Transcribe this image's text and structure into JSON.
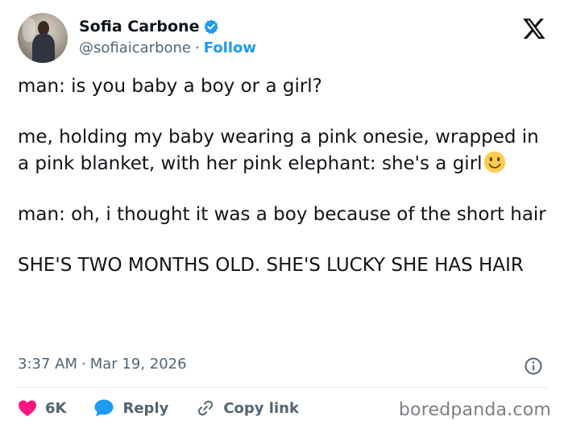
{
  "author": {
    "display_name": "Sofia Carbone",
    "handle": "@sofiaicarbone",
    "separator": "·",
    "follow_label": "Follow",
    "verified": true
  },
  "tweet": {
    "paragraphs": [
      "man: is you baby a boy or a girl?",
      "me, holding my baby wearing a pink onesie, wrapped in a pink blanket, with her pink elephant: she's a girl",
      "man: oh, i thought it was a boy because of the short hair",
      "SHE'S TWO MONTHS OLD. SHE'S LUCKY SHE HAS HAIR"
    ],
    "emoji": "slightly-smiling-face"
  },
  "meta": {
    "time": "3:37 AM",
    "separator": "·",
    "date": "Mar 19, 2026"
  },
  "actions": {
    "like_count": "6K",
    "reply_label": "Reply",
    "copy_link_label": "Copy link"
  },
  "watermark": "boredpanda.com",
  "colors": {
    "text": "#0f1419",
    "secondary": "#536471",
    "link": "#1d9bf0",
    "like": "#f91880",
    "verified": "#1d9bf0"
  }
}
